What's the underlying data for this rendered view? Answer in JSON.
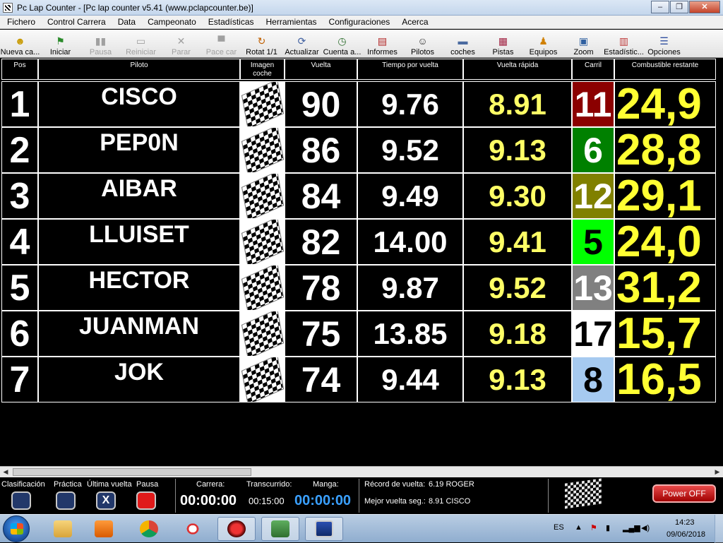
{
  "window": {
    "title": "Pc Lap Counter - [Pc lap counter v5.41 (www.pclapcounter.be)]"
  },
  "menu": [
    "Fichero",
    "Control Carrera",
    "Data",
    "Campeonato",
    "Estadísticas",
    "Herramientas",
    "Configuraciones",
    "Acerca"
  ],
  "toolbar": [
    {
      "label": "Nueva ca...",
      "icon": "new-race-icon",
      "enabled": true
    },
    {
      "label": "Iniciar",
      "icon": "start-flag-icon",
      "enabled": true
    },
    {
      "label": "Pausa",
      "icon": "pause-icon",
      "enabled": false
    },
    {
      "label": "Reiniciar",
      "icon": "restart-icon",
      "enabled": false
    },
    {
      "label": "Parar",
      "icon": "stop-icon",
      "enabled": false
    },
    {
      "label": "Pace car",
      "icon": "pace-car-icon",
      "enabled": false
    },
    {
      "label": "Rotat 1/1",
      "icon": "rotate-icon",
      "enabled": true
    },
    {
      "label": "Actualizar",
      "icon": "refresh-icon",
      "enabled": true
    },
    {
      "label": "Cuenta a...",
      "icon": "countdown-icon",
      "enabled": true
    },
    {
      "label": "Informes",
      "icon": "reports-icon",
      "enabled": true
    },
    {
      "label": "Pilotos",
      "icon": "drivers-icon",
      "enabled": true
    },
    {
      "label": "coches",
      "icon": "cars-icon",
      "enabled": true
    },
    {
      "label": "Pistas",
      "icon": "tracks-icon",
      "enabled": true
    },
    {
      "label": "Equipos",
      "icon": "teams-icon",
      "enabled": true
    },
    {
      "label": "Zoom",
      "icon": "zoom-icon",
      "enabled": true
    },
    {
      "label": "Estadístic...",
      "icon": "statistics-icon",
      "enabled": true
    },
    {
      "label": "Opciones",
      "icon": "options-icon",
      "enabled": true
    }
  ],
  "columns": {
    "pos": "Pos",
    "pilot": "Piloto",
    "image_l1": "Imagen",
    "image_l2": "coche",
    "lap": "Vuelta",
    "lap_time": "Tiempo por vuelta",
    "best_lap": "Vuelta rápida",
    "lane": "Carril",
    "fuel": "Combustible restante"
  },
  "rows": [
    {
      "pos": "1",
      "pilot": "CISCO",
      "lap": "90",
      "lap_time": "9.76",
      "best_lap": "8.91",
      "lane": "11",
      "lane_bg": "#8b0000",
      "lane_fg": "#ffffff",
      "fuel": "24,9"
    },
    {
      "pos": "2",
      "pilot": "PEP0N",
      "lap": "86",
      "lap_time": "9.52",
      "best_lap": "9.13",
      "lane": "6",
      "lane_bg": "#008000",
      "lane_fg": "#ffffff",
      "fuel": "28,8"
    },
    {
      "pos": "3",
      "pilot": "AIBAR",
      "lap": "84",
      "lap_time": "9.49",
      "best_lap": "9.30",
      "lane": "12",
      "lane_bg": "#808000",
      "lane_fg": "#ffffff",
      "fuel": "29,1"
    },
    {
      "pos": "4",
      "pilot": "LLUISET",
      "lap": "82",
      "lap_time": "14.00",
      "best_lap": "9.41",
      "lane": "5",
      "lane_bg": "#00ff00",
      "lane_fg": "#000000",
      "fuel": "24,0"
    },
    {
      "pos": "5",
      "pilot": "HECTOR",
      "lap": "78",
      "lap_time": "9.87",
      "best_lap": "9.52",
      "lane": "13",
      "lane_bg": "#808080",
      "lane_fg": "#ffffff",
      "fuel": "31,2"
    },
    {
      "pos": "6",
      "pilot": "JUANMAN",
      "lap": "75",
      "lap_time": "13.85",
      "best_lap": "9.18",
      "lane": "17",
      "lane_bg": "#ffffff",
      "lane_fg": "#000000",
      "fuel": "15,7"
    },
    {
      "pos": "7",
      "pilot": "JOK",
      "lap": "74",
      "lap_time": "9.44",
      "best_lap": "9.13",
      "lane": "8",
      "lane_bg": "#a6caf0",
      "lane_fg": "#000000",
      "fuel": "16,5"
    }
  ],
  "status": {
    "clasificacion": "Clasificación",
    "practica": "Práctica",
    "ultima_vuelta": "Última vuelta",
    "pausa": "Pausa",
    "ultima_vuelta_btn": "X",
    "carrera_label": "Carrera:",
    "carrera_value": "00:00:00",
    "transcurrido_label": "Transcurrido:",
    "transcurrido_value": "00:15:00",
    "manga_label": "Manga:",
    "manga_value": "00:00:00",
    "record_label": "Récord de vuelta:",
    "record_value": "6.19 ROGER",
    "best_label": "Mejor vuelta seg.:",
    "best_value": "8.91 CISCO",
    "power_off": "Power OFF"
  },
  "taskbar": {
    "lang": "ES",
    "time": "14:23",
    "date": "09/06/2018"
  }
}
